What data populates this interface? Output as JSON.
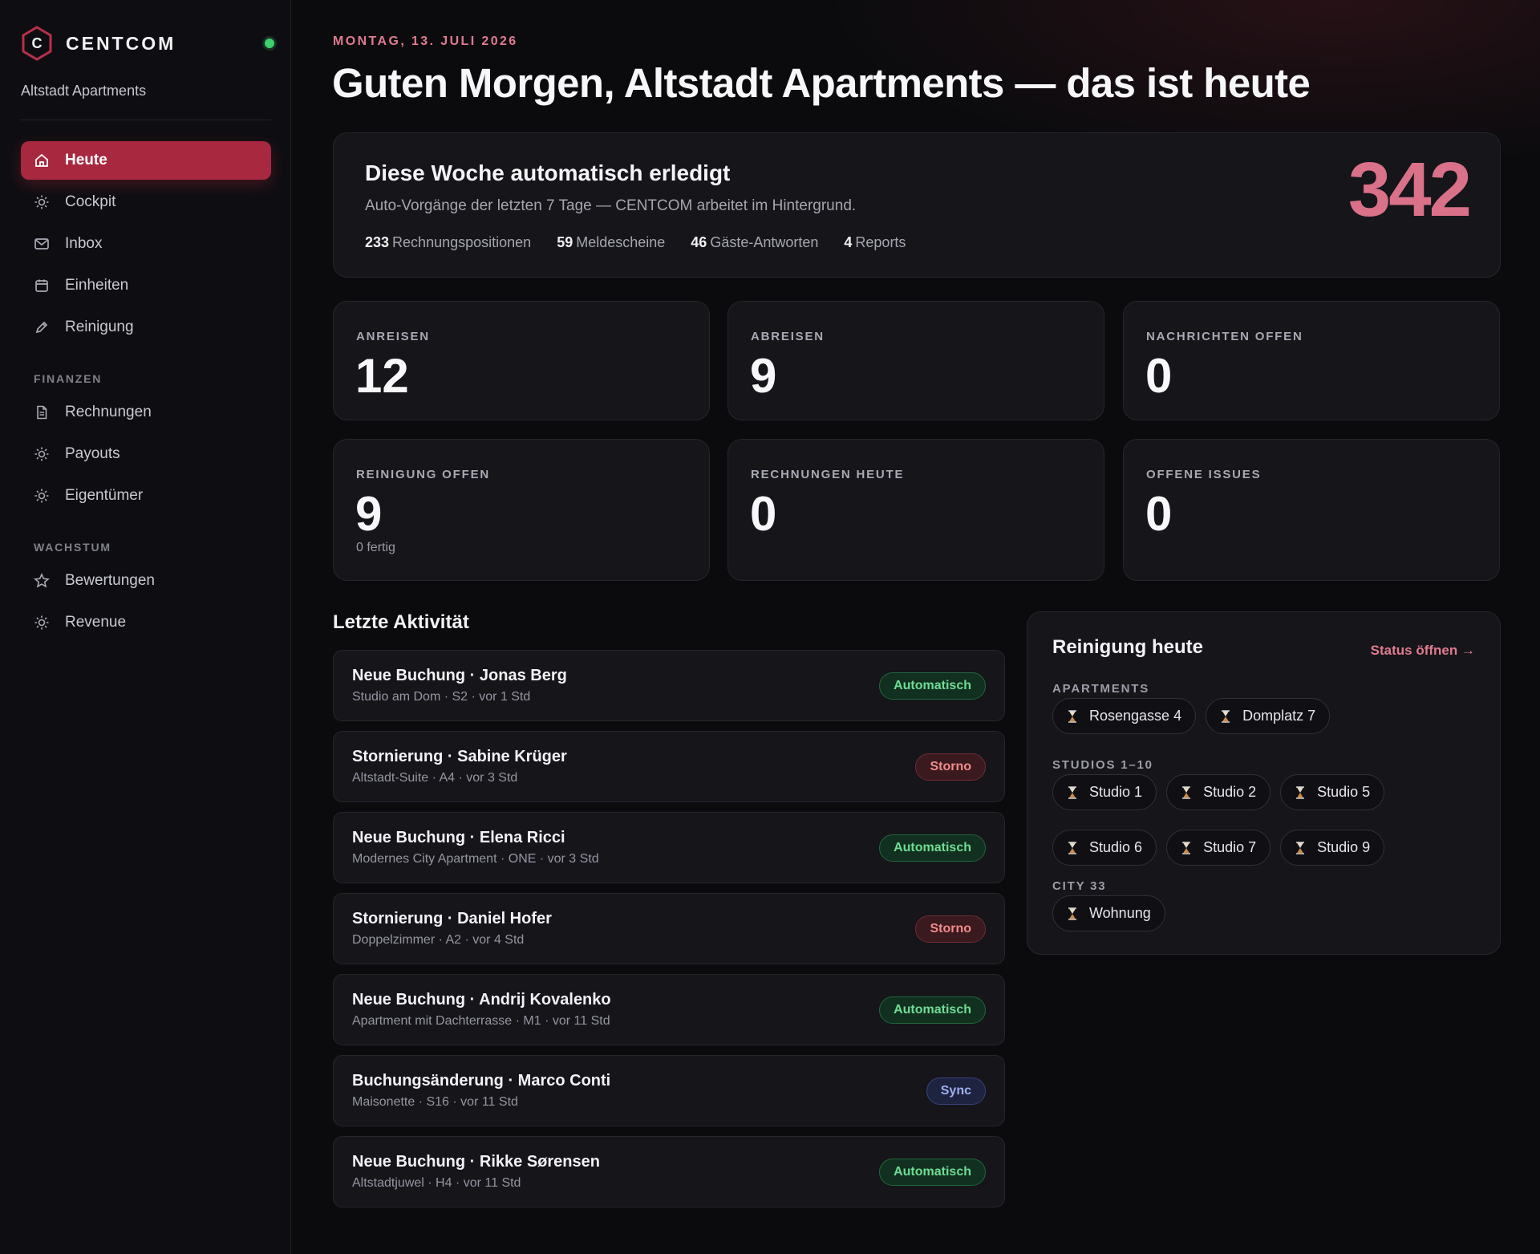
{
  "sidebar": {
    "brand": "CENTCOM",
    "logo_letter": "C",
    "org": "Altstadt Apartments",
    "items_main": [
      {
        "label": "Heute",
        "icon": "home-icon",
        "active": true
      },
      {
        "label": "Cockpit",
        "icon": "sun-icon"
      },
      {
        "label": "Inbox",
        "icon": "mail-icon"
      },
      {
        "label": "Einheiten",
        "icon": "calendar-icon"
      },
      {
        "label": "Reinigung",
        "icon": "pencil-icon"
      }
    ],
    "section_finanzen": "FINANZEN",
    "items_finanzen": [
      {
        "label": "Rechnungen",
        "icon": "document-icon"
      },
      {
        "label": "Payouts",
        "icon": "sun-icon"
      },
      {
        "label": "Eigentümer",
        "icon": "sun-icon"
      }
    ],
    "section_wachstum": "WACHSTUM",
    "items_wachstum": [
      {
        "label": "Bewertungen",
        "icon": "star-icon"
      },
      {
        "label": "Revenue",
        "icon": "sun-icon"
      }
    ]
  },
  "header": {
    "date": "MONTAG, 13. JULI 2026",
    "headline": "Guten Morgen, Altstadt Apartments — das ist heute"
  },
  "automation": {
    "title": "Diese Woche automatisch erledigt",
    "subtitle": "Auto-Vorgänge der letzten 7 Tage — CENTCOM arbeitet im Hintergrund.",
    "stats": [
      {
        "value": "233",
        "label": "Rechnungspositionen"
      },
      {
        "value": "59",
        "label": "Meldescheine"
      },
      {
        "value": "46",
        "label": "Gäste-Antworten"
      },
      {
        "value": "4",
        "label": "Reports"
      }
    ],
    "total": "342"
  },
  "kpis": [
    {
      "label": "ANREISEN",
      "value": "12",
      "note": ""
    },
    {
      "label": "ABREISEN",
      "value": "9",
      "note": ""
    },
    {
      "label": "NACHRICHTEN OFFEN",
      "value": "0",
      "note": ""
    },
    {
      "label": "REINIGUNG OFFEN",
      "value": "9",
      "note": "0 fertig"
    },
    {
      "label": "RECHNUNGEN HEUTE",
      "value": "0",
      "note": ""
    },
    {
      "label": "OFFENE ISSUES",
      "value": "0",
      "note": ""
    }
  ],
  "activity": {
    "title": "Letzte Aktivität",
    "rows": [
      {
        "title": "Neue Buchung · Jonas Berg",
        "sub": "Studio am Dom · S2 · vor 1 Std",
        "badge": "Automatisch",
        "kind": "auto"
      },
      {
        "title": "Stornierung · Sabine Krüger",
        "sub": "Altstadt-Suite · A4 · vor 3 Std",
        "badge": "Storno",
        "kind": "storno"
      },
      {
        "title": "Neue Buchung · Elena Ricci",
        "sub": "Modernes City Apartment · ONE · vor 3 Std",
        "badge": "Automatisch",
        "kind": "auto"
      },
      {
        "title": "Stornierung · Daniel Hofer",
        "sub": "Doppelzimmer · A2 · vor 4 Std",
        "badge": "Storno",
        "kind": "storno"
      },
      {
        "title": "Neue Buchung · Andrij Kovalenko",
        "sub": "Apartment mit Dachterrasse · M1 · vor 11 Std",
        "badge": "Automatisch",
        "kind": "auto"
      },
      {
        "title": "Buchungsänderung · Marco Conti",
        "sub": "Maisonette · S16 · vor 11 Std",
        "badge": "Sync",
        "kind": "sync"
      },
      {
        "title": "Neue Buchung · Rikke Sørensen",
        "sub": "Altstadtjuwel · H4 · vor 11 Std",
        "badge": "Automatisch",
        "kind": "auto"
      }
    ]
  },
  "cleaning": {
    "title": "Reinigung heute",
    "link": "Status öffnen →",
    "groups": [
      {
        "label": "APARTMENTS",
        "units": [
          "Rosengasse 4",
          "Domplatz 7"
        ]
      },
      {
        "label": "STUDIOS 1–10",
        "units": [
          "Studio 1",
          "Studio 2",
          "Studio 5",
          "Studio 6",
          "Studio 7",
          "Studio 9"
        ]
      },
      {
        "label": "CITY 33",
        "units": [
          "Wohnung"
        ]
      }
    ],
    "chip_icon": "hourglass-icon"
  },
  "colors": {
    "accent": "#a8283f",
    "accent_text": "#e07b8e",
    "total": "#d97188",
    "online": "#3ecf6e",
    "badge_auto": "#6fdc95",
    "badge_storno": "#f08c8c",
    "badge_sync": "#9fb0f3"
  }
}
